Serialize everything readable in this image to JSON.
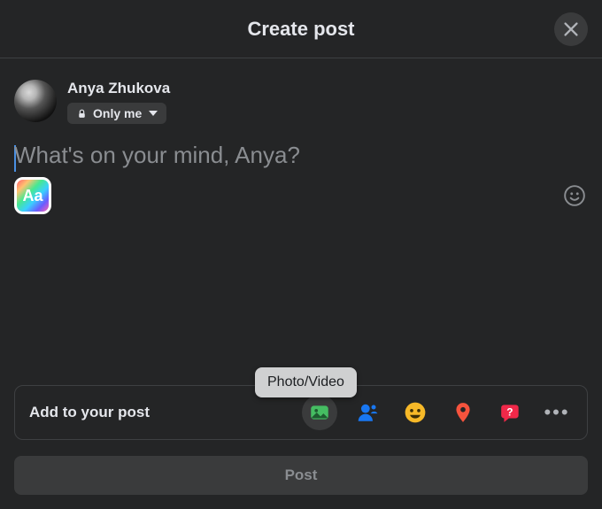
{
  "header": {
    "title": "Create post"
  },
  "user": {
    "name": "Anya Zhukova",
    "audience_label": "Only me"
  },
  "composer": {
    "placeholder": "What's on your mind, Anya?",
    "bg_button_label": "Aa"
  },
  "tooltip": {
    "photo_video": "Photo/Video"
  },
  "add_bar": {
    "label": "Add to your post"
  },
  "post_button": {
    "label": "Post"
  },
  "colors": {
    "accent_green": "#45bd62",
    "accent_blue": "#1877f2",
    "accent_yellow": "#f7b928",
    "accent_red": "#f02849",
    "accent_pin": "#f5533d"
  }
}
